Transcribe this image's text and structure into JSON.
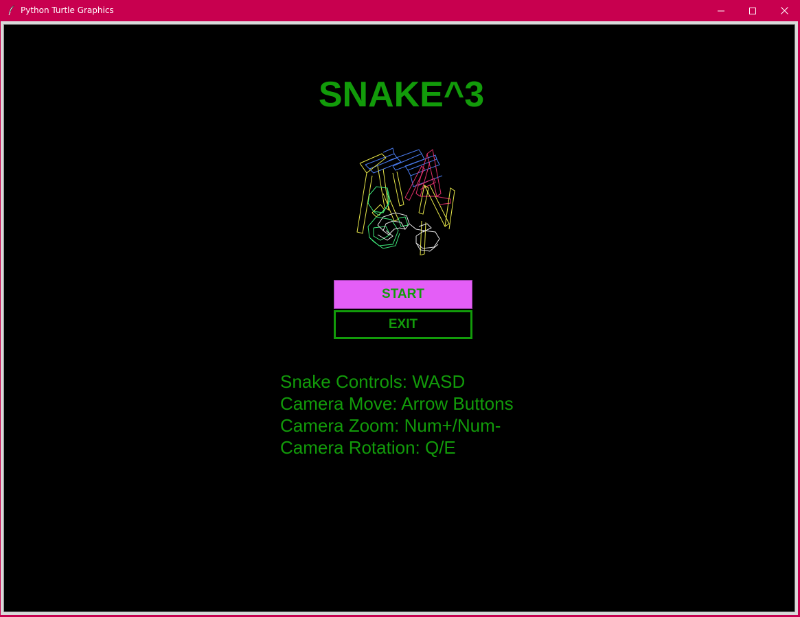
{
  "window": {
    "title": "Python Turtle Graphics",
    "title_bar_color": "#c8004f",
    "icons": {
      "app": "feather-icon",
      "minimize": "minimize-icon",
      "maximize": "maximize-icon",
      "close": "close-icon"
    }
  },
  "game": {
    "title": "SNAKE^3",
    "accent_color": "#129b0a",
    "background_color": "#000000",
    "logo_icon": "wireframe-snake-cube-logo",
    "menu": {
      "start_label": "START",
      "start_bg_color": "#e45ef7",
      "exit_label": "EXIT"
    },
    "controls": [
      "Snake Controls: WASD",
      "Camera Move: Arrow Buttons",
      "Camera Zoom: Num+/Num-",
      "Camera Rotation: Q/E"
    ]
  }
}
